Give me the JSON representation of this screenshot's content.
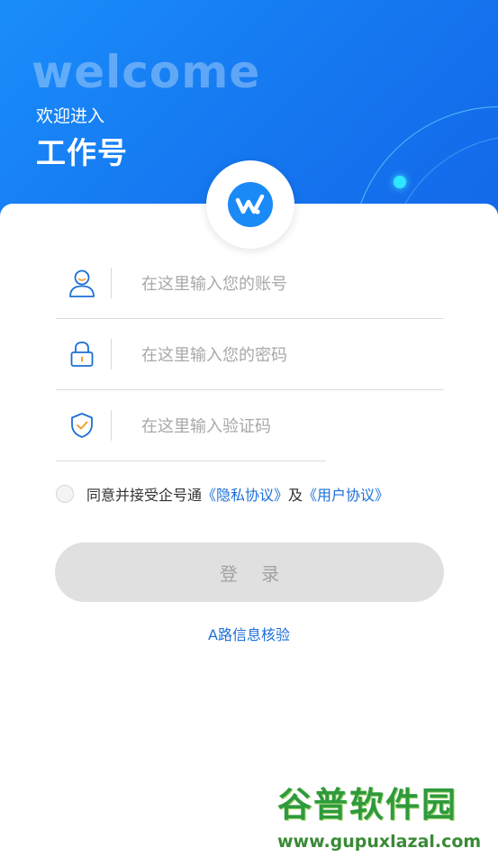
{
  "header": {
    "welcome": "welcome",
    "subtitle": "欢迎进入",
    "brand": "工作号"
  },
  "form": {
    "account_placeholder": "在这里输入您的账号",
    "password_placeholder": "在这里输入您的密码",
    "code_placeholder": "在这里输入验证码"
  },
  "agreement": {
    "text": "同意并接受企号通",
    "privacy_link": "《隐私协议》",
    "and": "及",
    "user_link": "《用户协议》"
  },
  "login_button": "登 录",
  "verify_link": "A路信息核验",
  "watermark": {
    "title": "谷普软件园",
    "url": "www.gupuxlazal.com"
  },
  "icons": {
    "account": "user-icon",
    "password": "lock-icon",
    "code": "shield-check-icon",
    "logo": "app-logo-icon"
  },
  "colors": {
    "primary": "#1a8af7",
    "link": "#1c6fd8",
    "button_disabled": "#e0e0e0"
  }
}
